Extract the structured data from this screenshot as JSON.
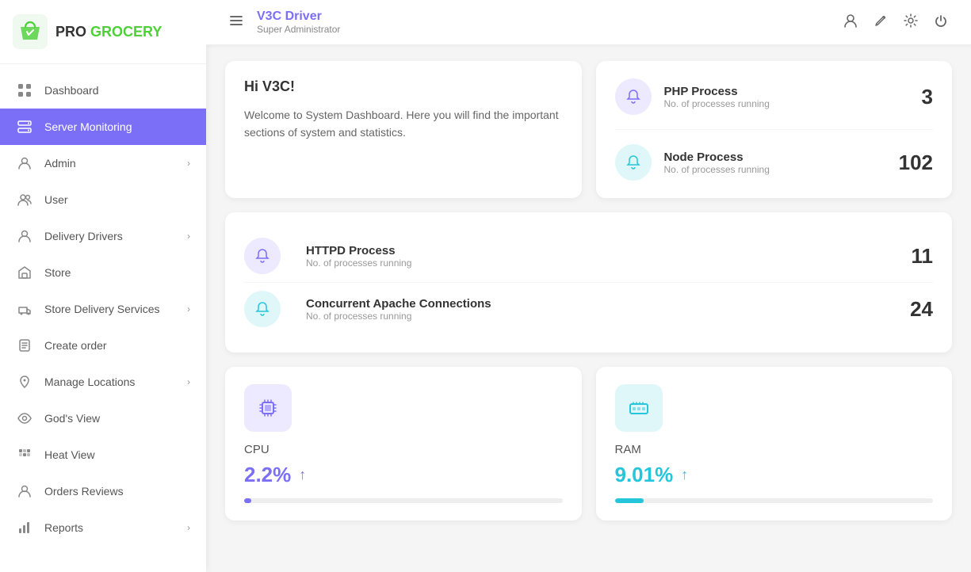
{
  "brand": {
    "pro": "PRO",
    "grocery": "GROCERY"
  },
  "sidebar": {
    "items": [
      {
        "id": "dashboard",
        "label": "Dashboard",
        "icon": "grid-icon",
        "active": false,
        "hasChevron": false
      },
      {
        "id": "server-monitoring",
        "label": "Server Monitoring",
        "icon": "server-icon",
        "active": true,
        "hasChevron": false
      },
      {
        "id": "admin",
        "label": "Admin",
        "icon": "person-icon",
        "active": false,
        "hasChevron": true
      },
      {
        "id": "user",
        "label": "User",
        "icon": "users-icon",
        "active": false,
        "hasChevron": false
      },
      {
        "id": "delivery-drivers",
        "label": "Delivery Drivers",
        "icon": "driver-icon",
        "active": false,
        "hasChevron": true
      },
      {
        "id": "store",
        "label": "Store",
        "icon": "store-icon",
        "active": false,
        "hasChevron": false
      },
      {
        "id": "store-delivery-services",
        "label": "Store Delivery Services",
        "icon": "delivery-icon",
        "active": false,
        "hasChevron": true
      },
      {
        "id": "create-order",
        "label": "Create order",
        "icon": "order-icon",
        "active": false,
        "hasChevron": false
      },
      {
        "id": "manage-locations",
        "label": "Manage Locations",
        "icon": "location-icon",
        "active": false,
        "hasChevron": true
      },
      {
        "id": "gods-view",
        "label": "God's View",
        "icon": "eye-icon",
        "active": false,
        "hasChevron": false
      },
      {
        "id": "heat-view",
        "label": "Heat View",
        "icon": "heatmap-icon",
        "active": false,
        "hasChevron": false
      },
      {
        "id": "orders-reviews",
        "label": "Orders Reviews",
        "icon": "reviews-icon",
        "active": false,
        "hasChevron": false
      },
      {
        "id": "reports",
        "label": "Reports",
        "icon": "reports-icon",
        "active": false,
        "hasChevron": true
      }
    ]
  },
  "topbar": {
    "driver_name": "V3C Driver",
    "role": "Super Administrator"
  },
  "welcome": {
    "greeting": "Hi V3C!",
    "message": "Welcome to System Dashboard. Here you will find the important sections of system and statistics."
  },
  "processes": {
    "php": {
      "name": "PHP Process",
      "subtitle": "No. of processes running",
      "count": "3"
    },
    "node": {
      "name": "Node Process",
      "subtitle": "No. of processes running",
      "count": "102"
    },
    "httpd": {
      "name": "HTTPD Process",
      "subtitle": "No. of processes running",
      "count": "11"
    },
    "apache": {
      "name": "Concurrent Apache Connections",
      "subtitle": "No. of processes running",
      "count": "24"
    }
  },
  "metrics": {
    "cpu": {
      "label": "CPU",
      "value": "2.2%",
      "progress": 2.2
    },
    "ram": {
      "label": "RAM",
      "value": "9.01%",
      "progress": 9.01
    }
  }
}
